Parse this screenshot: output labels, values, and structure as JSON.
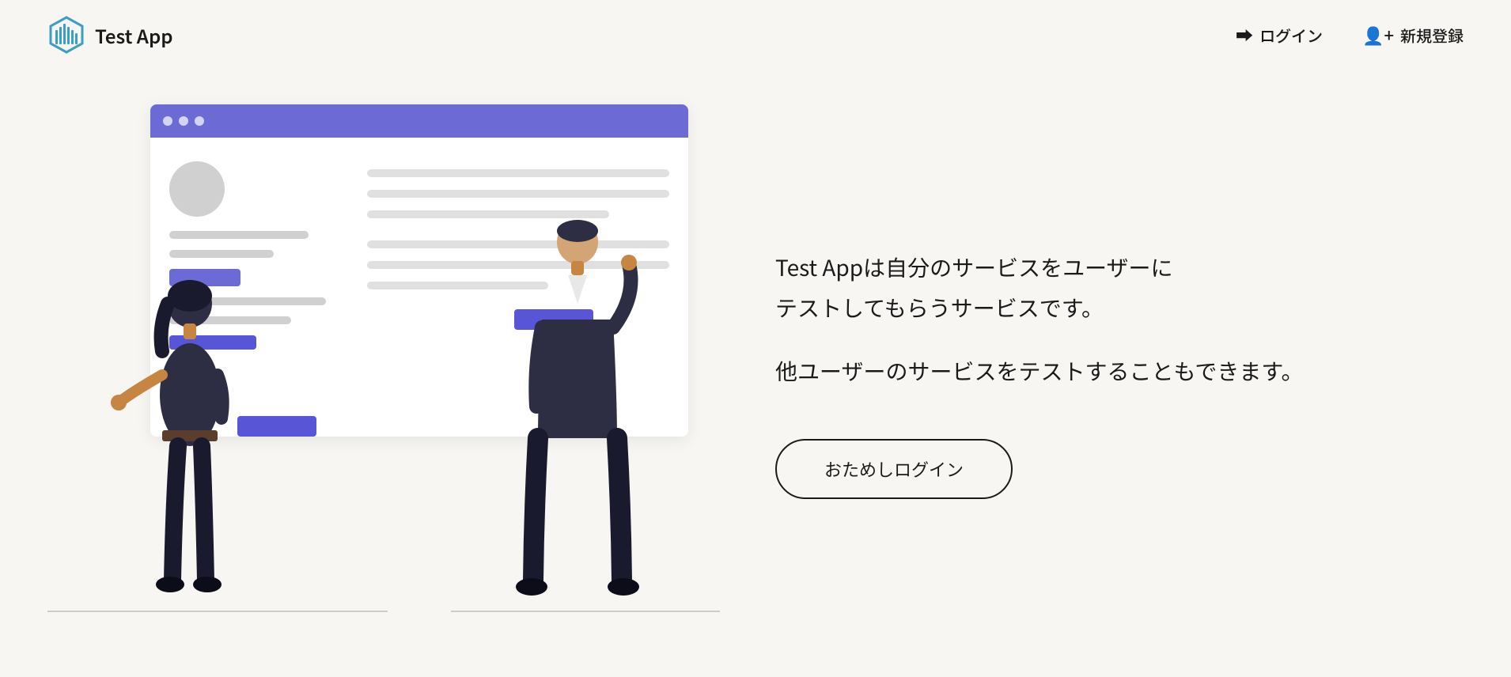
{
  "header": {
    "logo_text": "Test App",
    "login_label": "ログイン",
    "register_label": "新規登録"
  },
  "hero": {
    "line1": "Test Appは自分のサービスをユーザーに",
    "line2": "テストしてもらうサービスです。",
    "line3": "他ユーザーのサービスをテストすることもできます。",
    "trial_btn": "おためしログイン"
  },
  "browser": {
    "dots": [
      "●",
      "●",
      "●"
    ]
  }
}
